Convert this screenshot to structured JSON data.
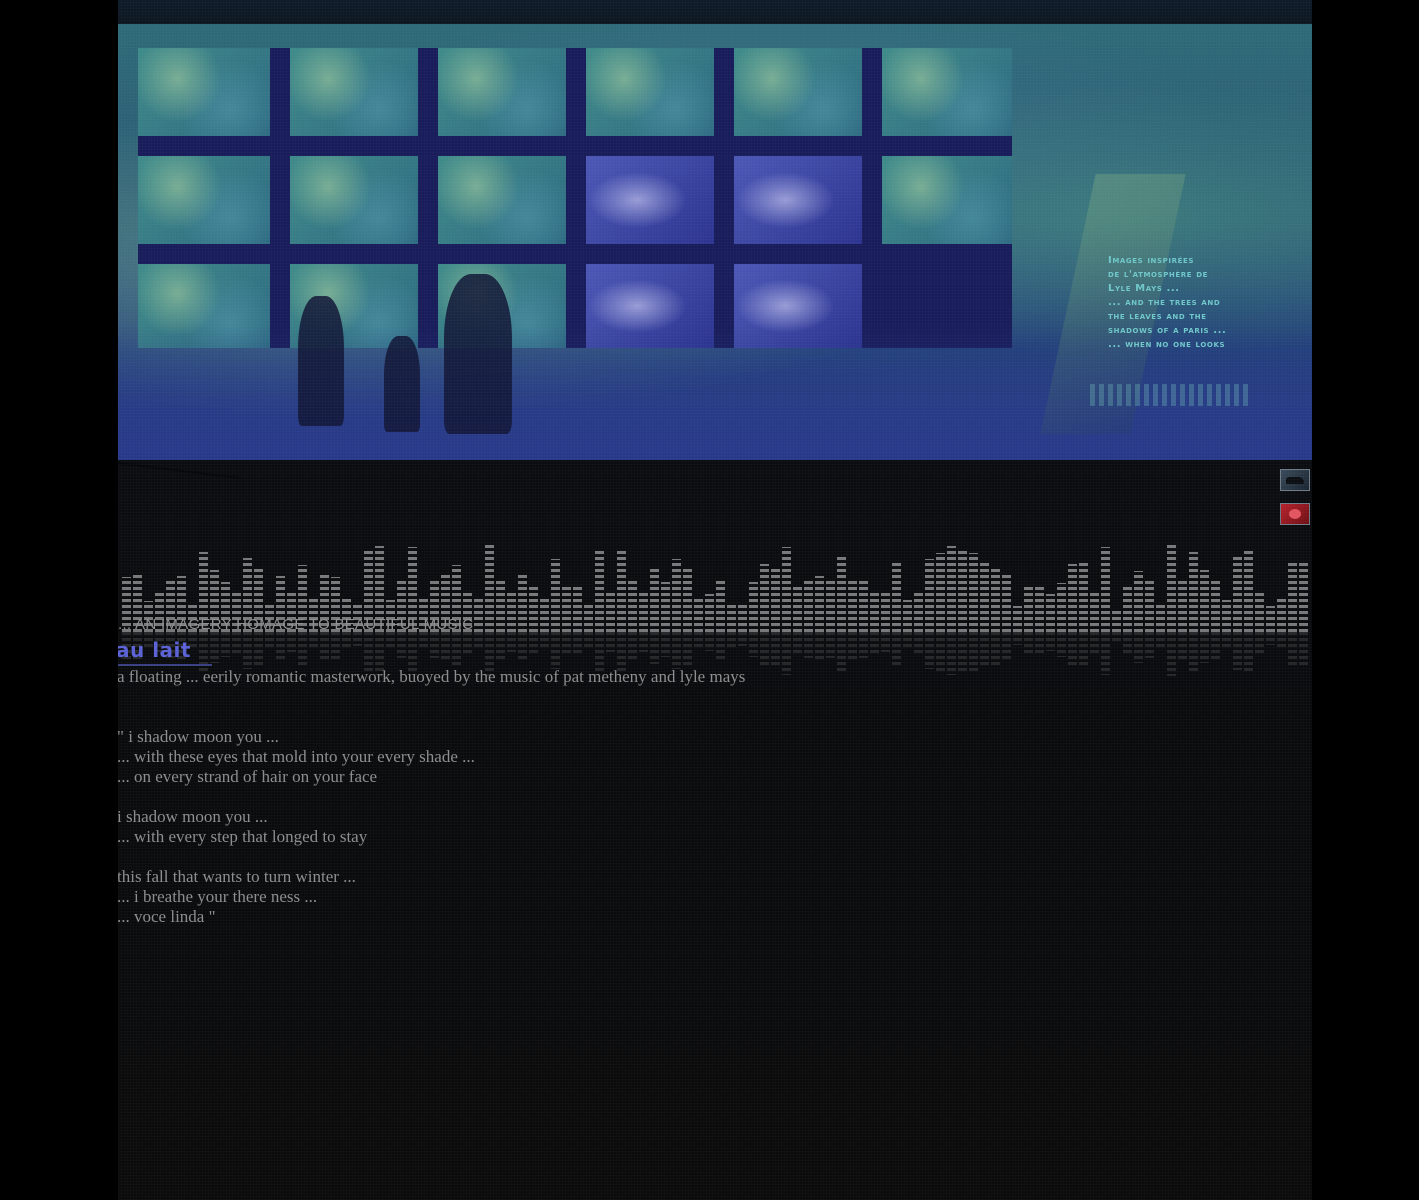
{
  "banner": {
    "caption_lines": [
      "Images inspirées",
      "de l'atmosphère de",
      "Lyle Mays ...",
      "... and the trees and",
      "the leaves and the",
      "shadows of a paris ...",
      "... when no one looks"
    ]
  },
  "icons": {
    "dark_icon": "car-thumbnail-icon",
    "red_icon": "red-thumbnail-icon"
  },
  "content": {
    "tagline": "... AN  IMAGERY HOMAGE TO BEAUTIFUL MUSIC",
    "title": "au lait",
    "description": "a floating ... eerily romantic masterwork, buoyed by the music of pat metheny and lyle mays",
    "poem": [
      "\" i shadow moon you ...",
      "... with these eyes that mold into your every shade ...",
      "... on every strand of hair on your face",
      "",
      "i shadow moon you ...",
      "... with every step that longed to stay",
      "",
      "this fall that wants to turn winter ...",
      "... i breathe your there ness ...",
      "... voce linda \""
    ]
  },
  "colors": {
    "background": "#000000",
    "title_accent": "#5b62d6",
    "text": "#8d8d8d",
    "caption": "#6fc7c9"
  }
}
